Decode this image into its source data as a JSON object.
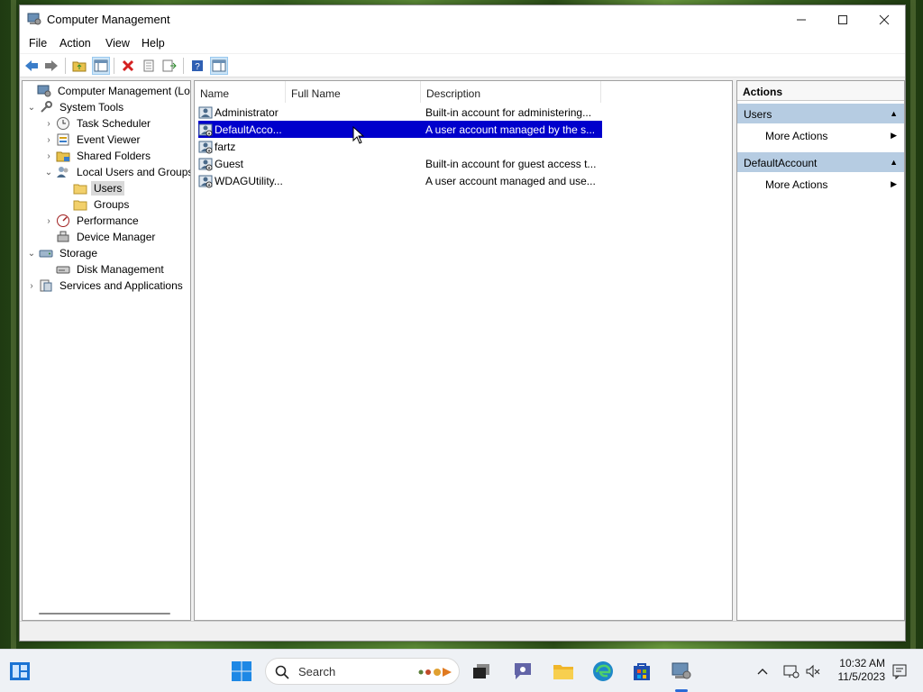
{
  "window": {
    "title": "Computer Management",
    "controls": {
      "minimize": "—",
      "maximize": "☐",
      "close": "✕"
    }
  },
  "menu": [
    "File",
    "Action",
    "View",
    "Help"
  ],
  "tree": [
    {
      "label": "Computer Management (Local",
      "level": 0,
      "chevron": "",
      "icon": "computer-management-icon"
    },
    {
      "label": "System Tools",
      "level": 0,
      "chevron": "⌄",
      "icon": "system-tools-icon"
    },
    {
      "label": "Task Scheduler",
      "level": 1,
      "chevron": "›",
      "icon": "clock-icon"
    },
    {
      "label": "Event Viewer",
      "level": 1,
      "chevron": "›",
      "icon": "event-viewer-icon"
    },
    {
      "label": "Shared Folders",
      "level": 1,
      "chevron": "›",
      "icon": "shared-folders-icon"
    },
    {
      "label": "Local Users and Groups",
      "level": 1,
      "chevron": "⌄",
      "icon": "users-groups-icon"
    },
    {
      "label": "Users",
      "level": 2,
      "chevron": "",
      "icon": "folder-icon",
      "selected": true
    },
    {
      "label": "Groups",
      "level": 2,
      "chevron": "",
      "icon": "folder-icon"
    },
    {
      "label": "Performance",
      "level": 1,
      "chevron": "›",
      "icon": "performance-icon"
    },
    {
      "label": "Device Manager",
      "level": 1,
      "chevron": "",
      "icon": "device-manager-icon"
    },
    {
      "label": "Storage",
      "level": 0,
      "chevron": "⌄",
      "icon": "storage-icon"
    },
    {
      "label": "Disk Management",
      "level": 1,
      "chevron": "",
      "icon": "disk-icon"
    },
    {
      "label": "Services and Applications",
      "level": 0,
      "chevron": "›",
      "icon": "services-icon"
    }
  ],
  "list": {
    "columns": [
      "Name",
      "Full Name",
      "Description"
    ],
    "rows": [
      {
        "name": "Administrator",
        "full_name": "",
        "description": "Built-in account for administering..."
      },
      {
        "name": "DefaultAcco...",
        "full_name": "",
        "description": "A user account managed by the s...",
        "selected": true
      },
      {
        "name": "fartz",
        "full_name": "",
        "description": ""
      },
      {
        "name": "Guest",
        "full_name": "",
        "description": "Built-in account for guest access t..."
      },
      {
        "name": "WDAGUtility...",
        "full_name": "",
        "description": "A user account managed and use..."
      }
    ]
  },
  "actions": {
    "title": "Actions",
    "sections": [
      {
        "header": "Users",
        "item": "More Actions"
      },
      {
        "header": "DefaultAccount",
        "item": "More Actions"
      }
    ]
  },
  "taskbar": {
    "search_placeholder": "Search",
    "time": "10:32 AM",
    "date": "11/5/2023"
  },
  "colors": {
    "selection": "#0000cc",
    "section_header": "#b6cce2",
    "accent": "#2a6ad6"
  }
}
